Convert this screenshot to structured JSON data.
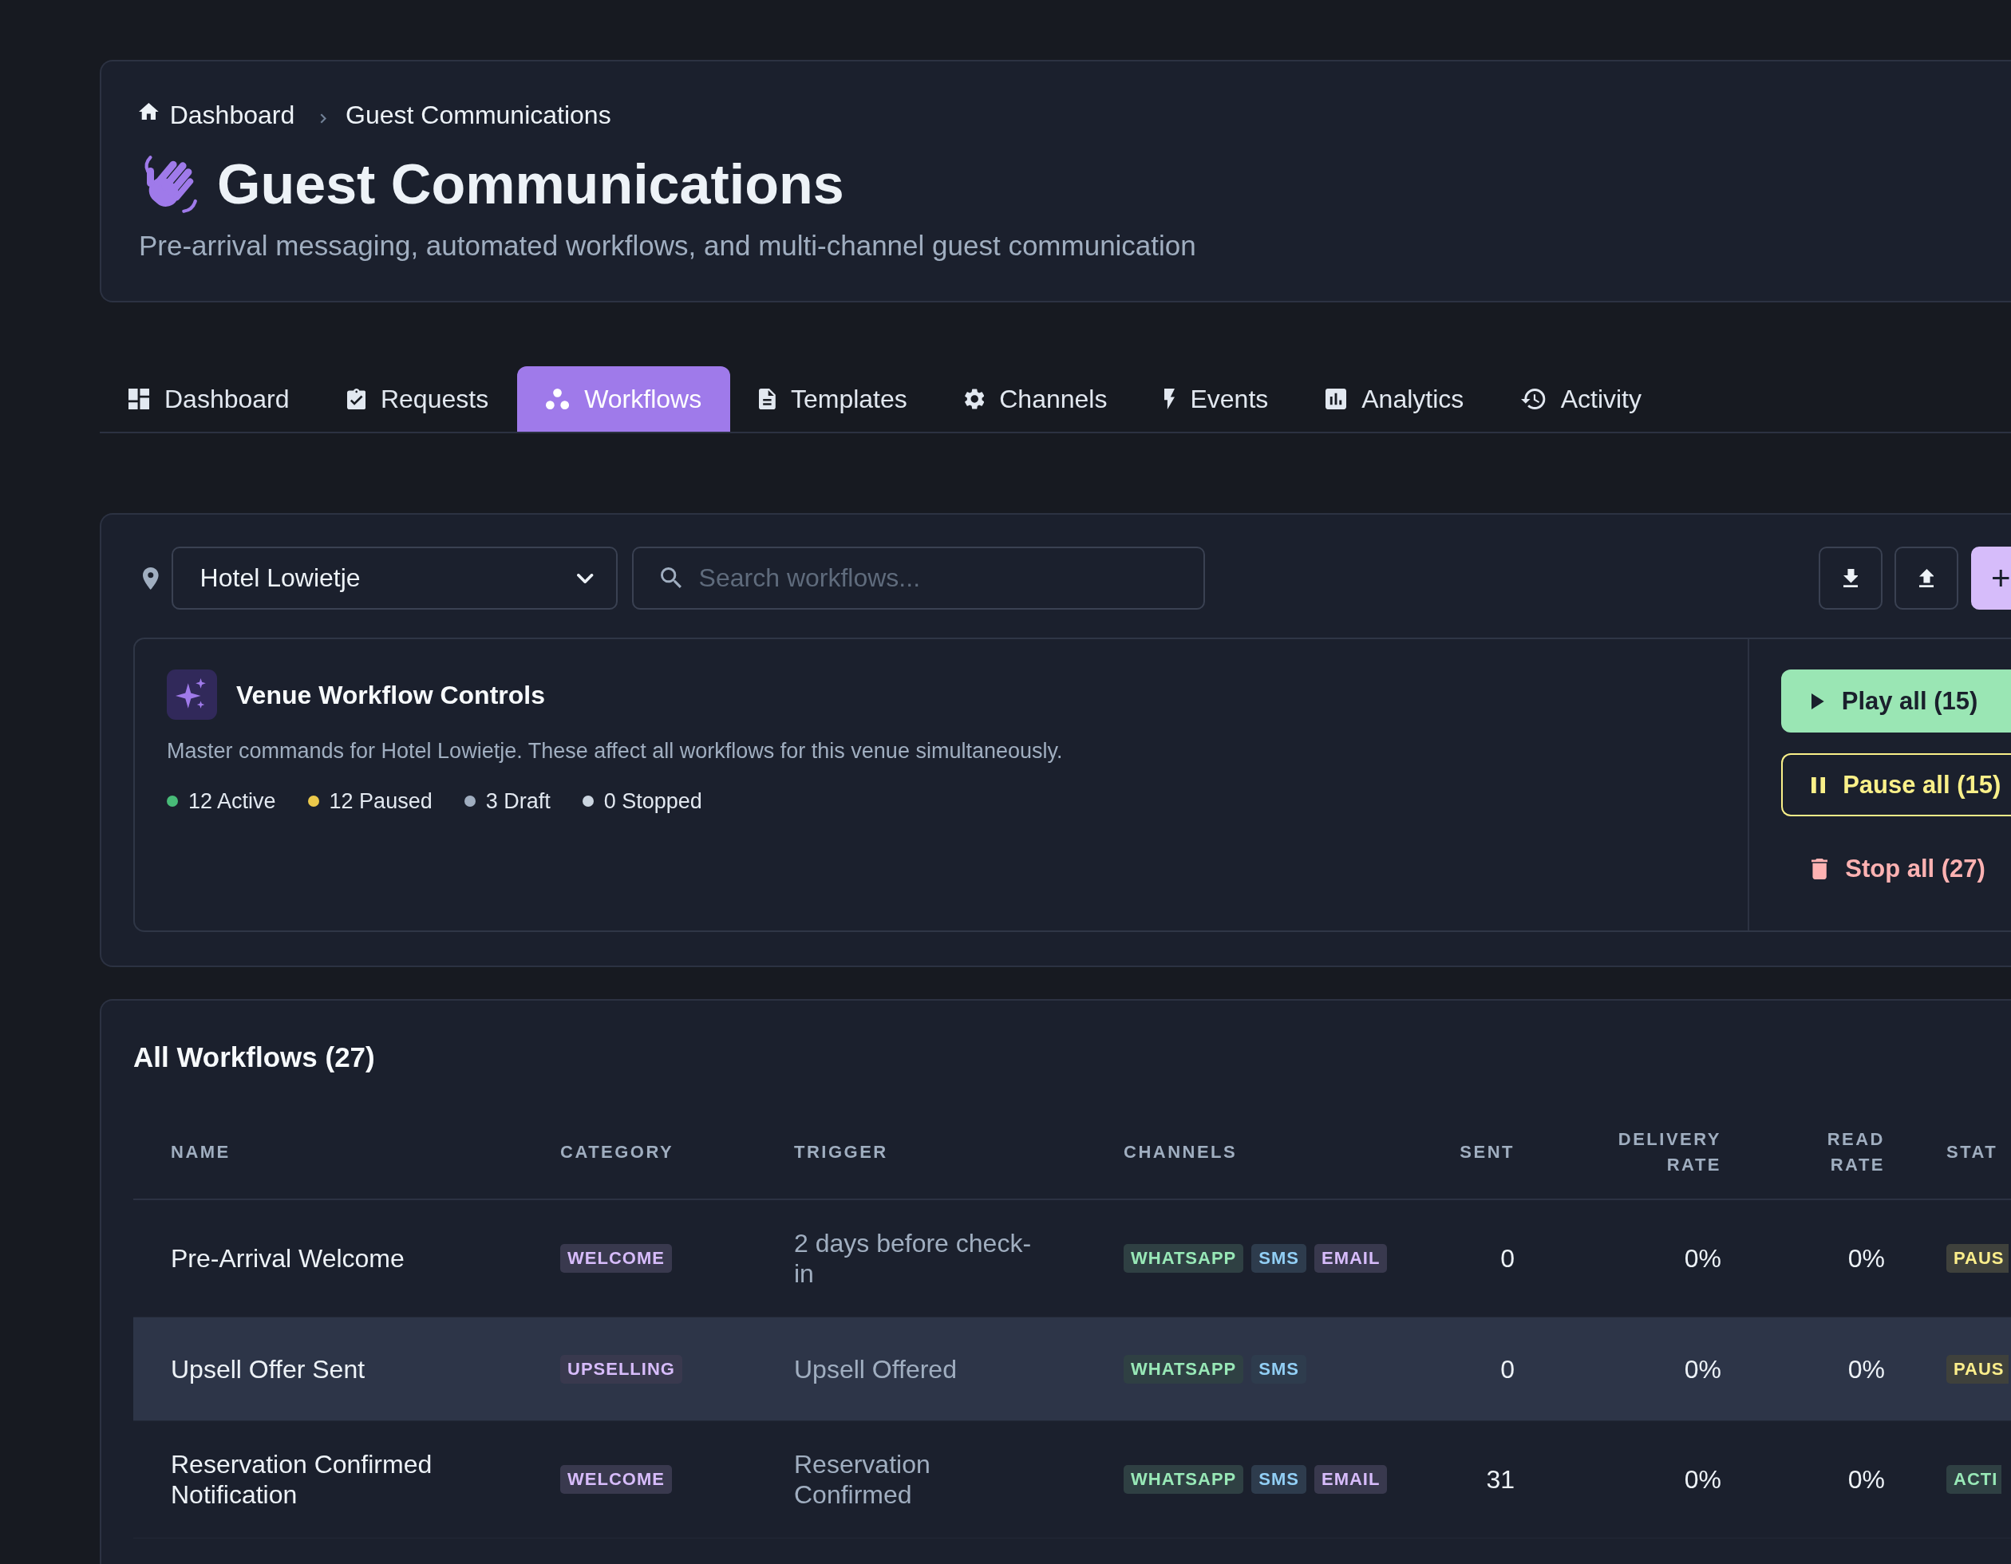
{
  "breadcrumb": [
    {
      "kind": "home",
      "label": "Dashboard"
    },
    {
      "kind": "current",
      "label": "Guest Communications"
    }
  ],
  "header": {
    "title": "Guest Communications",
    "subtitle": "Pre-arrival messaging, automated workflows, and multi-channel guest communication"
  },
  "tabs": [
    {
      "label": "Dashboard",
      "selected": false
    },
    {
      "label": "Requests",
      "selected": false
    },
    {
      "label": "Workflows",
      "selected": true
    },
    {
      "label": "Templates",
      "selected": false
    },
    {
      "label": "Channels",
      "selected": false
    },
    {
      "label": "Events",
      "selected": false
    },
    {
      "label": "Analytics",
      "selected": false
    },
    {
      "label": "Activity",
      "selected": false
    }
  ],
  "toolbar": {
    "venue_select": {
      "value": "Hotel Lowietje"
    },
    "search": {
      "placeholder": "Search workflows..."
    },
    "add_button": {
      "label": "+"
    }
  },
  "venue_controls": {
    "title": "Venue Workflow Controls",
    "description": "Master commands for Hotel Lowietje. These affect all workflows for this venue simultaneously.",
    "counts": [
      {
        "label": "12 Active",
        "color": "#48bb78"
      },
      {
        "label": "12 Paused",
        "color": "#ecc94b"
      },
      {
        "label": "3 Draft",
        "color": "#a0aec0"
      },
      {
        "label": "0 Stopped",
        "color": "#cbd5e0"
      }
    ],
    "actions": [
      {
        "kind": "play",
        "label": "Play all (15)"
      },
      {
        "kind": "pause",
        "label": "Pause all (15)"
      },
      {
        "kind": "stop",
        "label": "Stop all (27)"
      }
    ]
  },
  "table": {
    "title": "All Workflows (27)",
    "columns": [
      "NAME",
      "CATEGORY",
      "TRIGGER",
      "CHANNELS",
      "SENT",
      "DELIVERY RATE",
      "READ RATE",
      "STAT"
    ],
    "rows": [
      {
        "selected": false,
        "name": "Pre-Arrival Welcome",
        "category": {
          "label": "WELCOME",
          "color": "#39394e"
        },
        "trigger": "2 days before check-in",
        "channels": [
          {
            "label": "WHATSAPP",
            "color": "#2f4043"
          },
          {
            "label": "SMS",
            "color": "#2e3c4d"
          },
          {
            "label": "EMAIL",
            "color": "#39394e"
          }
        ],
        "sent": "0",
        "delivery_rate": "0%",
        "read_rate": "0%",
        "status": {
          "label": "PAUS",
          "color": "#3f413c"
        }
      },
      {
        "selected": true,
        "name": "Upsell Offer Sent",
        "category": {
          "label": "UPSELLING",
          "color": "#39394e"
        },
        "trigger": "Upsell Offered",
        "channels": [
          {
            "label": "WHATSAPP",
            "color": "#2f4043"
          },
          {
            "label": "SMS",
            "color": "#2e3c4d"
          }
        ],
        "sent": "0",
        "delivery_rate": "0%",
        "read_rate": "0%",
        "status": {
          "label": "PAUS",
          "color": "#3f413c"
        }
      },
      {
        "selected": false,
        "name": "Reservation Confirmed Notification",
        "category": {
          "label": "WELCOME",
          "color": "#39394e"
        },
        "trigger": "Reservation Confirmed",
        "channels": [
          {
            "label": "WHATSAPP",
            "color": "#2f4043"
          },
          {
            "label": "SMS",
            "color": "#2e3c4d"
          },
          {
            "label": "EMAIL",
            "color": "#39394e"
          }
        ],
        "sent": "31",
        "delivery_rate": "0%",
        "read_rate": "0%",
        "status": {
          "label": "ACTI",
          "color": "#2f4043"
        }
      }
    ]
  }
}
